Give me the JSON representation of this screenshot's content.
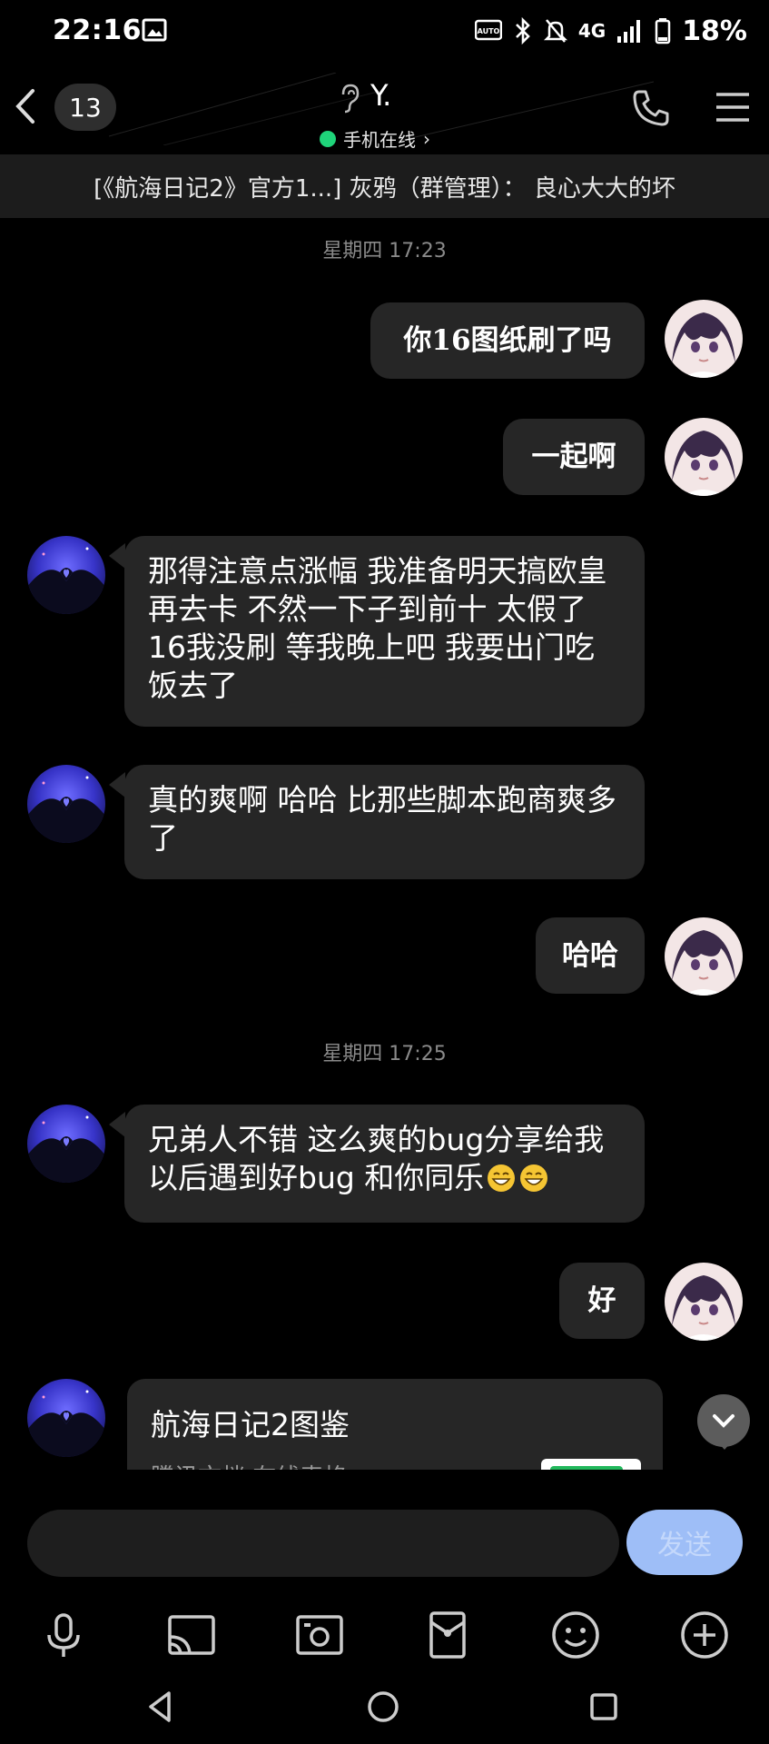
{
  "status_bar": {
    "time": "22:16",
    "network": "4G",
    "battery": "18%",
    "icons": [
      "image-icon",
      "auto-brightness-icon",
      "bluetooth-icon",
      "mute-icon",
      "signal-icon",
      "battery-icon"
    ]
  },
  "header": {
    "unread_count": "13",
    "title": "Y.",
    "subtitle": "手机在线",
    "subtitle_arrow": "›",
    "icons": [
      "back-arrow-icon",
      "ear-icon",
      "phone-icon",
      "menu-icon"
    ]
  },
  "notice": {
    "text": "[《航海日记2》官方1...] 灰鸦（群管理）：  良心大大的坏"
  },
  "messages": {
    "time1": "星期四 17:23",
    "m1": "你16图纸刷了吗",
    "m2": "一起啊",
    "m3": "那得注意点涨幅 我准备明天搞欧皇 再去卡 不然一下子到前十 太假了  16我没刷 等我晚上吧 我要出门吃饭去了",
    "m4": "真的爽啊 哈哈  比那些脚本跑商爽多了",
    "m5": "哈哈",
    "time2": "星期四 17:25",
    "m6": "兄弟人不错 这么爽的bug分享给我 以后遇到好bug 和你同乐",
    "m7": "好",
    "card_title": "航海日记2图鉴",
    "card_sub": "腾讯文档  在线表格"
  },
  "composer": {
    "input_value": "",
    "send_label": "发送"
  },
  "toolbar": {
    "icons": [
      "microphone-icon",
      "screen-share-icon",
      "photo-icon",
      "red-packet-icon",
      "emoji-icon",
      "plus-icon"
    ]
  },
  "navigation": {
    "icons": [
      "nav-back-icon",
      "nav-home-icon",
      "nav-recents-icon"
    ]
  },
  "colors": {
    "background": "#000000",
    "bubble": "#262626",
    "send_button": "#9ebef7",
    "online": "#1fd47a"
  }
}
